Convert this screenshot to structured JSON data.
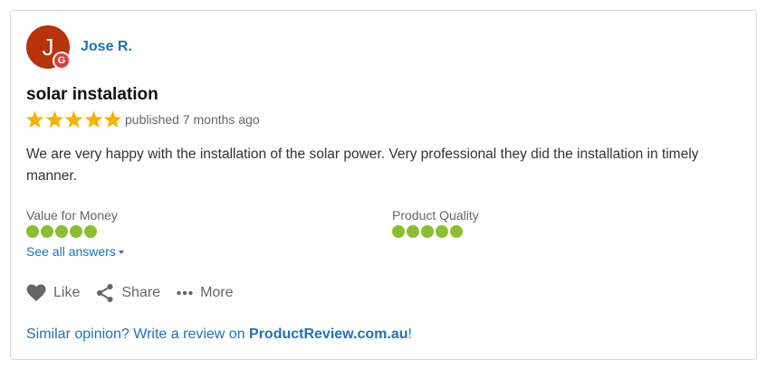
{
  "review": {
    "author_initial": "J",
    "source_badge": "G",
    "author": "Jose R.",
    "title": "solar instalation",
    "star_rating": 5,
    "published": "published 7 months ago",
    "body": "We are very happy with the installation of the solar power. Very professional they did the installation in timely manner."
  },
  "ratings": [
    {
      "label": "Value for Money",
      "score": 5
    },
    {
      "label": "Product Quality",
      "score": 5
    }
  ],
  "see_all": "See all answers",
  "actions": {
    "like": "Like",
    "share": "Share",
    "more": "More"
  },
  "footer": {
    "prefix": "Similar opinion? Write a review on ",
    "site": "ProductReview.com.au",
    "suffix": "!"
  },
  "colors": {
    "accent": "#1f6fbf",
    "star": "#f5b301",
    "dot": "#8bbf2e",
    "avatar": "#b8320b",
    "google_badge": "#e23b3b"
  },
  "icons": {
    "like": "heart-icon",
    "share": "share-icon",
    "more": "ellipsis-icon",
    "caret": "caret-down-icon",
    "star": "star-icon"
  }
}
